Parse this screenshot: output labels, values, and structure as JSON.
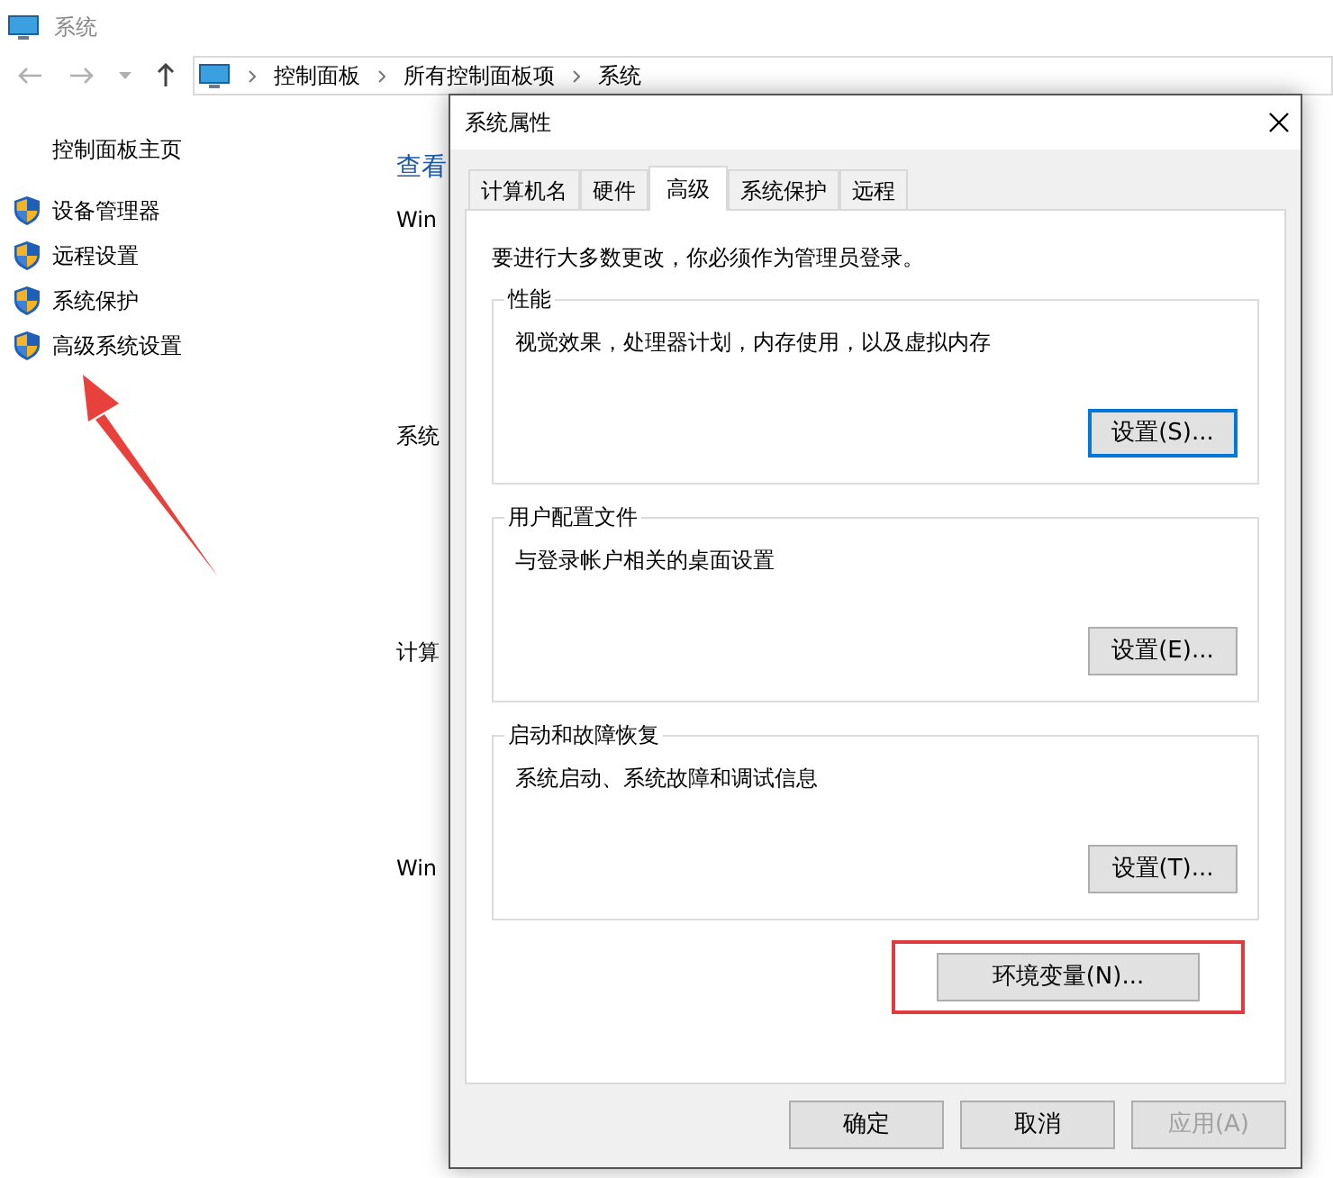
{
  "window": {
    "title": "系统"
  },
  "nav": {
    "breadcrumbs": [
      "控制面板",
      "所有控制面板项",
      "系统"
    ]
  },
  "sidebar": {
    "home": "控制面板主页",
    "items": [
      "设备管理器",
      "远程设置",
      "系统保护",
      "高级系统设置"
    ]
  },
  "background_fragments": [
    {
      "kind": "title",
      "text": "查看"
    },
    {
      "kind": "heading",
      "text": "Win"
    },
    {
      "kind": "heading",
      "text": "系统"
    },
    {
      "kind": "heading",
      "text": "计算"
    },
    {
      "kind": "heading",
      "text": "Win"
    }
  ],
  "dialog": {
    "title": "系统属性",
    "tabs": [
      {
        "label": "计算机名",
        "selected": false
      },
      {
        "label": "硬件",
        "selected": false
      },
      {
        "label": "高级",
        "selected": true
      },
      {
        "label": "系统保护",
        "selected": false
      },
      {
        "label": "远程",
        "selected": false
      }
    ],
    "notice": "要进行大多数更改，你必须作为管理员登录。",
    "groups": [
      {
        "title": "性能",
        "description": "视觉效果，处理器计划，内存使用，以及虚拟内存",
        "button": "设置(S)...",
        "focused": true
      },
      {
        "title": "用户配置文件",
        "description": "与登录帐户相关的桌面设置",
        "button": "设置(E)...",
        "focused": false
      },
      {
        "title": "启动和故障恢复",
        "description": "系统启动、系统故障和调试信息",
        "button": "设置(T)...",
        "focused": false
      }
    ],
    "env_button": {
      "label": "环境变量(N)...",
      "highlighted": true
    },
    "footer_buttons": [
      {
        "label": "确定",
        "disabled": false
      },
      {
        "label": "取消",
        "disabled": false
      },
      {
        "label": "应用(A)",
        "disabled": true
      }
    ]
  }
}
